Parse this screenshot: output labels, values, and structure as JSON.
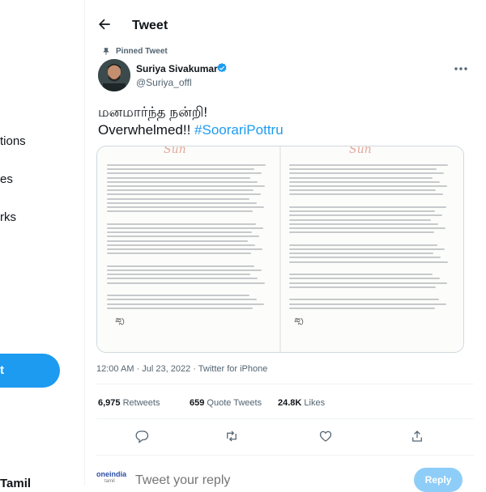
{
  "sidebar": {
    "items": [
      {
        "label": "tions"
      },
      {
        "label": "es"
      },
      {
        "label": "rks"
      }
    ],
    "tweet_button_label": "t",
    "bottom_user": "Tamil"
  },
  "header": {
    "title": "Tweet"
  },
  "tweet": {
    "pinned_label": "Pinned Tweet",
    "author_name": "Suriya Sivakumar",
    "author_handle": "@Suriya_offl",
    "text_line1": "மனமார்ந்த நன்றி!",
    "text_line2_plain": "Overwhelmed!! ",
    "hashtag": "#SoorariPottru",
    "timestamp": "12:00 AM · Jul 23, 2022 · Twitter for iPhone",
    "stats": {
      "retweets_count": "6,975",
      "retweets_label": " Retweets",
      "quotes_count": "659",
      "quotes_label": " Quote Tweets",
      "likes_count": "24.8K",
      "likes_label": " Likes"
    }
  },
  "reply": {
    "logo_text": "oneindia",
    "logo_sub": "tamil",
    "placeholder": "Tweet your reply",
    "button_label": "Reply"
  },
  "colors": {
    "accent": "#1d9bf0",
    "text_primary": "#0f1419",
    "text_secondary": "#536471"
  },
  "icons": [
    "back-arrow-icon",
    "pin-icon",
    "verified-badge-icon",
    "more-icon",
    "reply-icon",
    "retweet-icon",
    "like-icon",
    "share-icon"
  ]
}
